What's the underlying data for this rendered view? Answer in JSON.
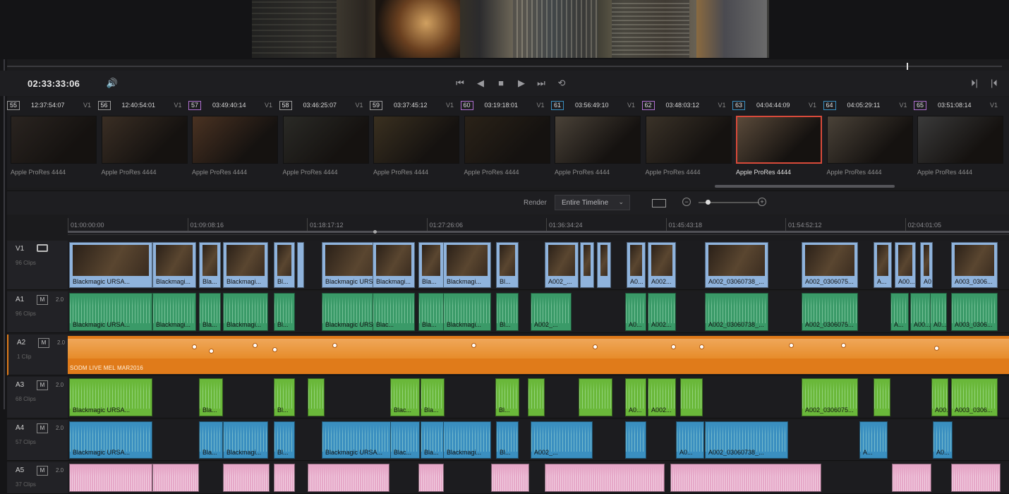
{
  "viewer": {
    "timecode": "02:33:33:06"
  },
  "transport": {
    "speaker": "🔊",
    "first": "⏮",
    "prev": "◀",
    "stop": "■",
    "play": "▶",
    "last": "⏭",
    "loop": "⟲",
    "nav_right": "⏵|",
    "nav_left": "|⏴"
  },
  "clips": [
    {
      "num": "55",
      "tc": "12:37:54:07",
      "track": "V1",
      "codec": "Apple ProRes 4444",
      "num_color": "#9a9a9a"
    },
    {
      "num": "56",
      "tc": "12:40:54:01",
      "track": "V1",
      "codec": "Apple ProRes 4444",
      "num_color": "#9a9a9a"
    },
    {
      "num": "57",
      "tc": "03:49:40:14",
      "track": "V1",
      "codec": "Apple ProRes 4444",
      "num_color": "#b070d0"
    },
    {
      "num": "58",
      "tc": "03:46:25:07",
      "track": "V1",
      "codec": "Apple ProRes 4444",
      "num_color": "#9a9a9a"
    },
    {
      "num": "59",
      "tc": "03:37:45:12",
      "track": "V1",
      "codec": "Apple ProRes 4444",
      "num_color": "#9a9a9a"
    },
    {
      "num": "60",
      "tc": "03:19:18:01",
      "track": "V1",
      "codec": "Apple ProRes 4444",
      "num_color": "#b070d0"
    },
    {
      "num": "61",
      "tc": "03:56:49:10",
      "track": "V1",
      "codec": "Apple ProRes 4444",
      "num_color": "#3a8fc0"
    },
    {
      "num": "62",
      "tc": "03:48:03:12",
      "track": "V1",
      "codec": "Apple ProRes 4444",
      "num_color": "#b070d0"
    },
    {
      "num": "63",
      "tc": "04:04:44:09",
      "track": "V1",
      "codec": "Apple ProRes 4444",
      "num_color": "#3a8fc0",
      "selected": true
    },
    {
      "num": "64",
      "tc": "04:05:29:11",
      "track": "V1",
      "codec": "Apple ProRes 4444",
      "num_color": "#3a8fc0"
    },
    {
      "num": "65",
      "tc": "03:51:08:14",
      "track": "V1",
      "codec": "Apple ProRes 4444",
      "num_color": "#b070d0"
    }
  ],
  "toolbar": {
    "render_label": "Render",
    "render_value": "Entire Timeline",
    "caret": "⌄",
    "zoom_out": "−",
    "zoom_in": "+"
  },
  "ruler": [
    "01:00:00:00",
    "01:09:08:16",
    "01:18:17:12",
    "01:27:26:06",
    "01:36:34:24",
    "01:45:43:18",
    "01:54:52:12",
    "02:04:01:05"
  ],
  "tracks": {
    "V1": {
      "name": "V1",
      "clips_label": "96 Clips"
    },
    "A1": {
      "name": "A1",
      "m": "M",
      "vol": "2.0",
      "clips_label": "96 Clips"
    },
    "A2": {
      "name": "A2",
      "m": "M",
      "vol": "2.0",
      "clips_label": "1 Clip",
      "clip_label": "SODM LIVE MEL MAR2016"
    },
    "A3": {
      "name": "A3",
      "m": "M",
      "vol": "2.0",
      "clips_label": "68 Clips"
    },
    "A4": {
      "name": "A4",
      "m": "M",
      "vol": "2.0",
      "clips_label": "57 Clips"
    },
    "A5": {
      "name": "A5",
      "m": "M",
      "vol": "2.0",
      "clips_label": "37 Clips"
    }
  },
  "lanes": {
    "v1": [
      {
        "l": "Blackmagic URSA..."
      },
      {
        "l": "Blackmagi..."
      },
      {
        "l": "Bla..."
      },
      {
        "l": "Blackmagi..."
      },
      {
        "l": "Bl..."
      },
      {
        "l": ""
      },
      {
        "l": "Blackmagic URSA..."
      },
      {
        "l": "Blackmagi..."
      },
      {
        "l": "Bla..."
      },
      {
        "l": "Blackmagi..."
      },
      {
        "l": "Bl..."
      },
      {
        "l": "A002_..."
      },
      {
        "l": ""
      },
      {
        "l": ""
      },
      {
        "l": "A0..."
      },
      {
        "l": "A002..."
      },
      {
        "l": "A002_03060738_..."
      },
      {
        "l": "A002_0306075..."
      },
      {
        "l": "A..."
      },
      {
        "l": "A00..."
      },
      {
        "l": "A0..."
      },
      {
        "l": "A003_0306..."
      }
    ],
    "a1": [
      {
        "l": "Blackmagic URSA..."
      },
      {
        "l": "Blackmagi..."
      },
      {
        "l": "Bla..."
      },
      {
        "l": "Blackmagi..."
      },
      {
        "l": "Bl..."
      },
      {
        "l": "Blackmagic URSA..."
      },
      {
        "l": "Blac..."
      },
      {
        "l": "Bla..."
      },
      {
        "l": "Blackmagi..."
      },
      {
        "l": "Bl..."
      },
      {
        "l": "A002_..."
      },
      {
        "l": "A0..."
      },
      {
        "l": "A002..."
      },
      {
        "l": "A002_03060738_..."
      },
      {
        "l": "A002_0306075..."
      },
      {
        "l": "A..."
      },
      {
        "l": "A00..."
      },
      {
        "l": "A0..."
      },
      {
        "l": "A003_0306..."
      }
    ],
    "a3": [
      {
        "l": "Blackmagic URSA..."
      },
      {
        "l": "Bla..."
      },
      {
        "l": "Bl..."
      },
      {
        "l": ""
      },
      {
        "l": "Blac..."
      },
      {
        "l": "Bla..."
      },
      {
        "l": "Bl..."
      },
      {
        "l": ""
      },
      {
        "l": ""
      },
      {
        "l": "A0..."
      },
      {
        "l": "A002..."
      },
      {
        "l": ""
      },
      {
        "l": "A002_0306075..."
      },
      {
        "l": ""
      },
      {
        "l": "A00..."
      },
      {
        "l": "A003_0306..."
      }
    ],
    "a4": [
      {
        "l": "Blackmagic URSA..."
      },
      {
        "l": "Bla..."
      },
      {
        "l": "Blackmagi..."
      },
      {
        "l": "Bl..."
      },
      {
        "l": "Blackmagic URSA..."
      },
      {
        "l": "Blac..."
      },
      {
        "l": "Bla..."
      },
      {
        "l": "Blackmagi..."
      },
      {
        "l": "Bl..."
      },
      {
        "l": "A002_..."
      },
      {
        "l": ""
      },
      {
        "l": "A0..."
      },
      {
        "l": "A002_03060738_..."
      },
      {
        "l": "A..."
      },
      {
        "l": "A0..."
      }
    ],
    "a5": [
      {
        "l": ""
      },
      {
        "l": ""
      },
      {
        "l": ""
      },
      {
        "l": ""
      },
      {
        "l": ""
      },
      {
        "l": ""
      },
      {
        "l": ""
      },
      {
        "l": ""
      },
      {
        "l": ""
      },
      {
        "l": ""
      }
    ]
  }
}
